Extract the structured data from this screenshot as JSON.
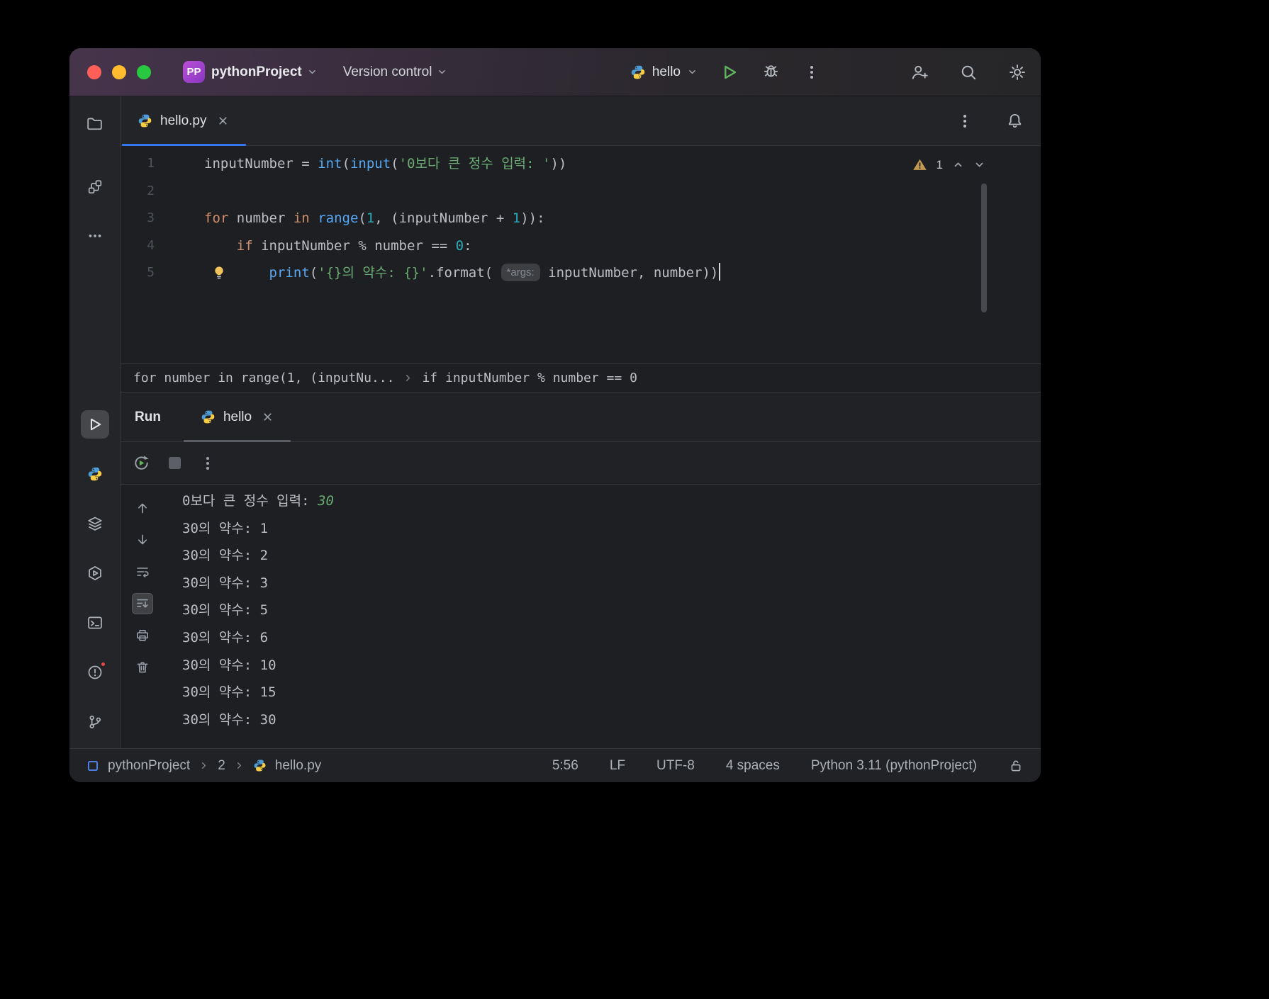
{
  "titlebar": {
    "project_badge": "PP",
    "project_name": "pythonProject",
    "version_control_label": "Version control",
    "run_config_name": "hello"
  },
  "tab_bar": {
    "active_tab": "hello.py"
  },
  "sidebar": {
    "items": [
      "project-folder",
      "structure",
      "more-tool-windows",
      "run",
      "python-console",
      "python-packages",
      "services",
      "terminal",
      "problems",
      "version-control"
    ],
    "active_item": "run"
  },
  "editor": {
    "warning_count": "1",
    "lines": [
      {
        "num": "1",
        "tokens": [
          {
            "t": "inputNumber = ",
            "c": "plain"
          },
          {
            "t": "int",
            "c": "func"
          },
          {
            "t": "(",
            "c": "plain"
          },
          {
            "t": "input",
            "c": "func"
          },
          {
            "t": "(",
            "c": "plain"
          },
          {
            "t": "'0보다 큰 정수 입력: '",
            "c": "str"
          },
          {
            "t": "))",
            "c": "plain"
          }
        ]
      },
      {
        "num": "2",
        "tokens": []
      },
      {
        "num": "3",
        "tokens": [
          {
            "t": "for",
            "c": "kw"
          },
          {
            "t": " number ",
            "c": "plain"
          },
          {
            "t": "in",
            "c": "kw"
          },
          {
            "t": " ",
            "c": "plain"
          },
          {
            "t": "range",
            "c": "func"
          },
          {
            "t": "(",
            "c": "plain"
          },
          {
            "t": "1",
            "c": "num"
          },
          {
            "t": ", (inputNumber + ",
            "c": "plain"
          },
          {
            "t": "1",
            "c": "num"
          },
          {
            "t": ")):",
            "c": "plain"
          }
        ]
      },
      {
        "num": "4",
        "tokens": [
          {
            "t": "    ",
            "c": "plain"
          },
          {
            "t": "if",
            "c": "kw"
          },
          {
            "t": " inputNumber % number == ",
            "c": "plain"
          },
          {
            "t": "0",
            "c": "num"
          },
          {
            "t": ":",
            "c": "plain"
          }
        ]
      },
      {
        "num": "5",
        "bulb": true,
        "tokens": [
          {
            "t": "        ",
            "c": "plain"
          },
          {
            "t": "print",
            "c": "func"
          },
          {
            "t": "(",
            "c": "plain"
          },
          {
            "t": "'{}의 약수: {}'",
            "c": "str"
          },
          {
            "t": ".format( ",
            "c": "plain"
          },
          {
            "t": "*args:",
            "c": "hint"
          },
          {
            "t": " inputNumber, number))",
            "c": "plain"
          },
          {
            "t": "",
            "c": "caret"
          }
        ]
      }
    ],
    "context_bar": {
      "segments": [
        "for number in range(1, (inputNu...",
        "if inputNumber % number == 0"
      ]
    }
  },
  "run_panel": {
    "title": "Run",
    "tab_name": "hello",
    "console_lines": [
      [
        {
          "t": "0보다 큰 정수 입력: ",
          "c": "out"
        },
        {
          "t": "30",
          "c": "input"
        }
      ],
      [
        {
          "t": "30의 약수: 1",
          "c": "out"
        }
      ],
      [
        {
          "t": "30의 약수: 2",
          "c": "out"
        }
      ],
      [
        {
          "t": "30의 약수: 3",
          "c": "out"
        }
      ],
      [
        {
          "t": "30의 약수: 5",
          "c": "out"
        }
      ],
      [
        {
          "t": "30의 약수: 6",
          "c": "out"
        }
      ],
      [
        {
          "t": "30의 약수: 10",
          "c": "out"
        }
      ],
      [
        {
          "t": "30의 약수: 15",
          "c": "out"
        }
      ],
      [
        {
          "t": "30의 약수: 30",
          "c": "out"
        }
      ]
    ]
  },
  "status_bar": {
    "path": [
      "pythonProject",
      "2",
      "hello.py"
    ],
    "caret_position": "5:56",
    "line_separator": "LF",
    "encoding": "UTF-8",
    "indent": "4 spaces",
    "interpreter": "Python 3.11 (pythonProject)"
  },
  "colors": {
    "accent_blue": "#3574f0",
    "keyword_orange": "#cf8e6d",
    "builtin_blue": "#56a8f5",
    "string_green": "#6aab73",
    "number_cyan": "#2aacb8",
    "user_input_green": "#6aab73",
    "badge_purple": "#a64ac9",
    "run_green": "#62b55f",
    "warning_yellow": "#c49a50",
    "traffic_red": "#ff5f57",
    "traffic_yellow": "#febc2e",
    "traffic_green": "#28c840"
  }
}
